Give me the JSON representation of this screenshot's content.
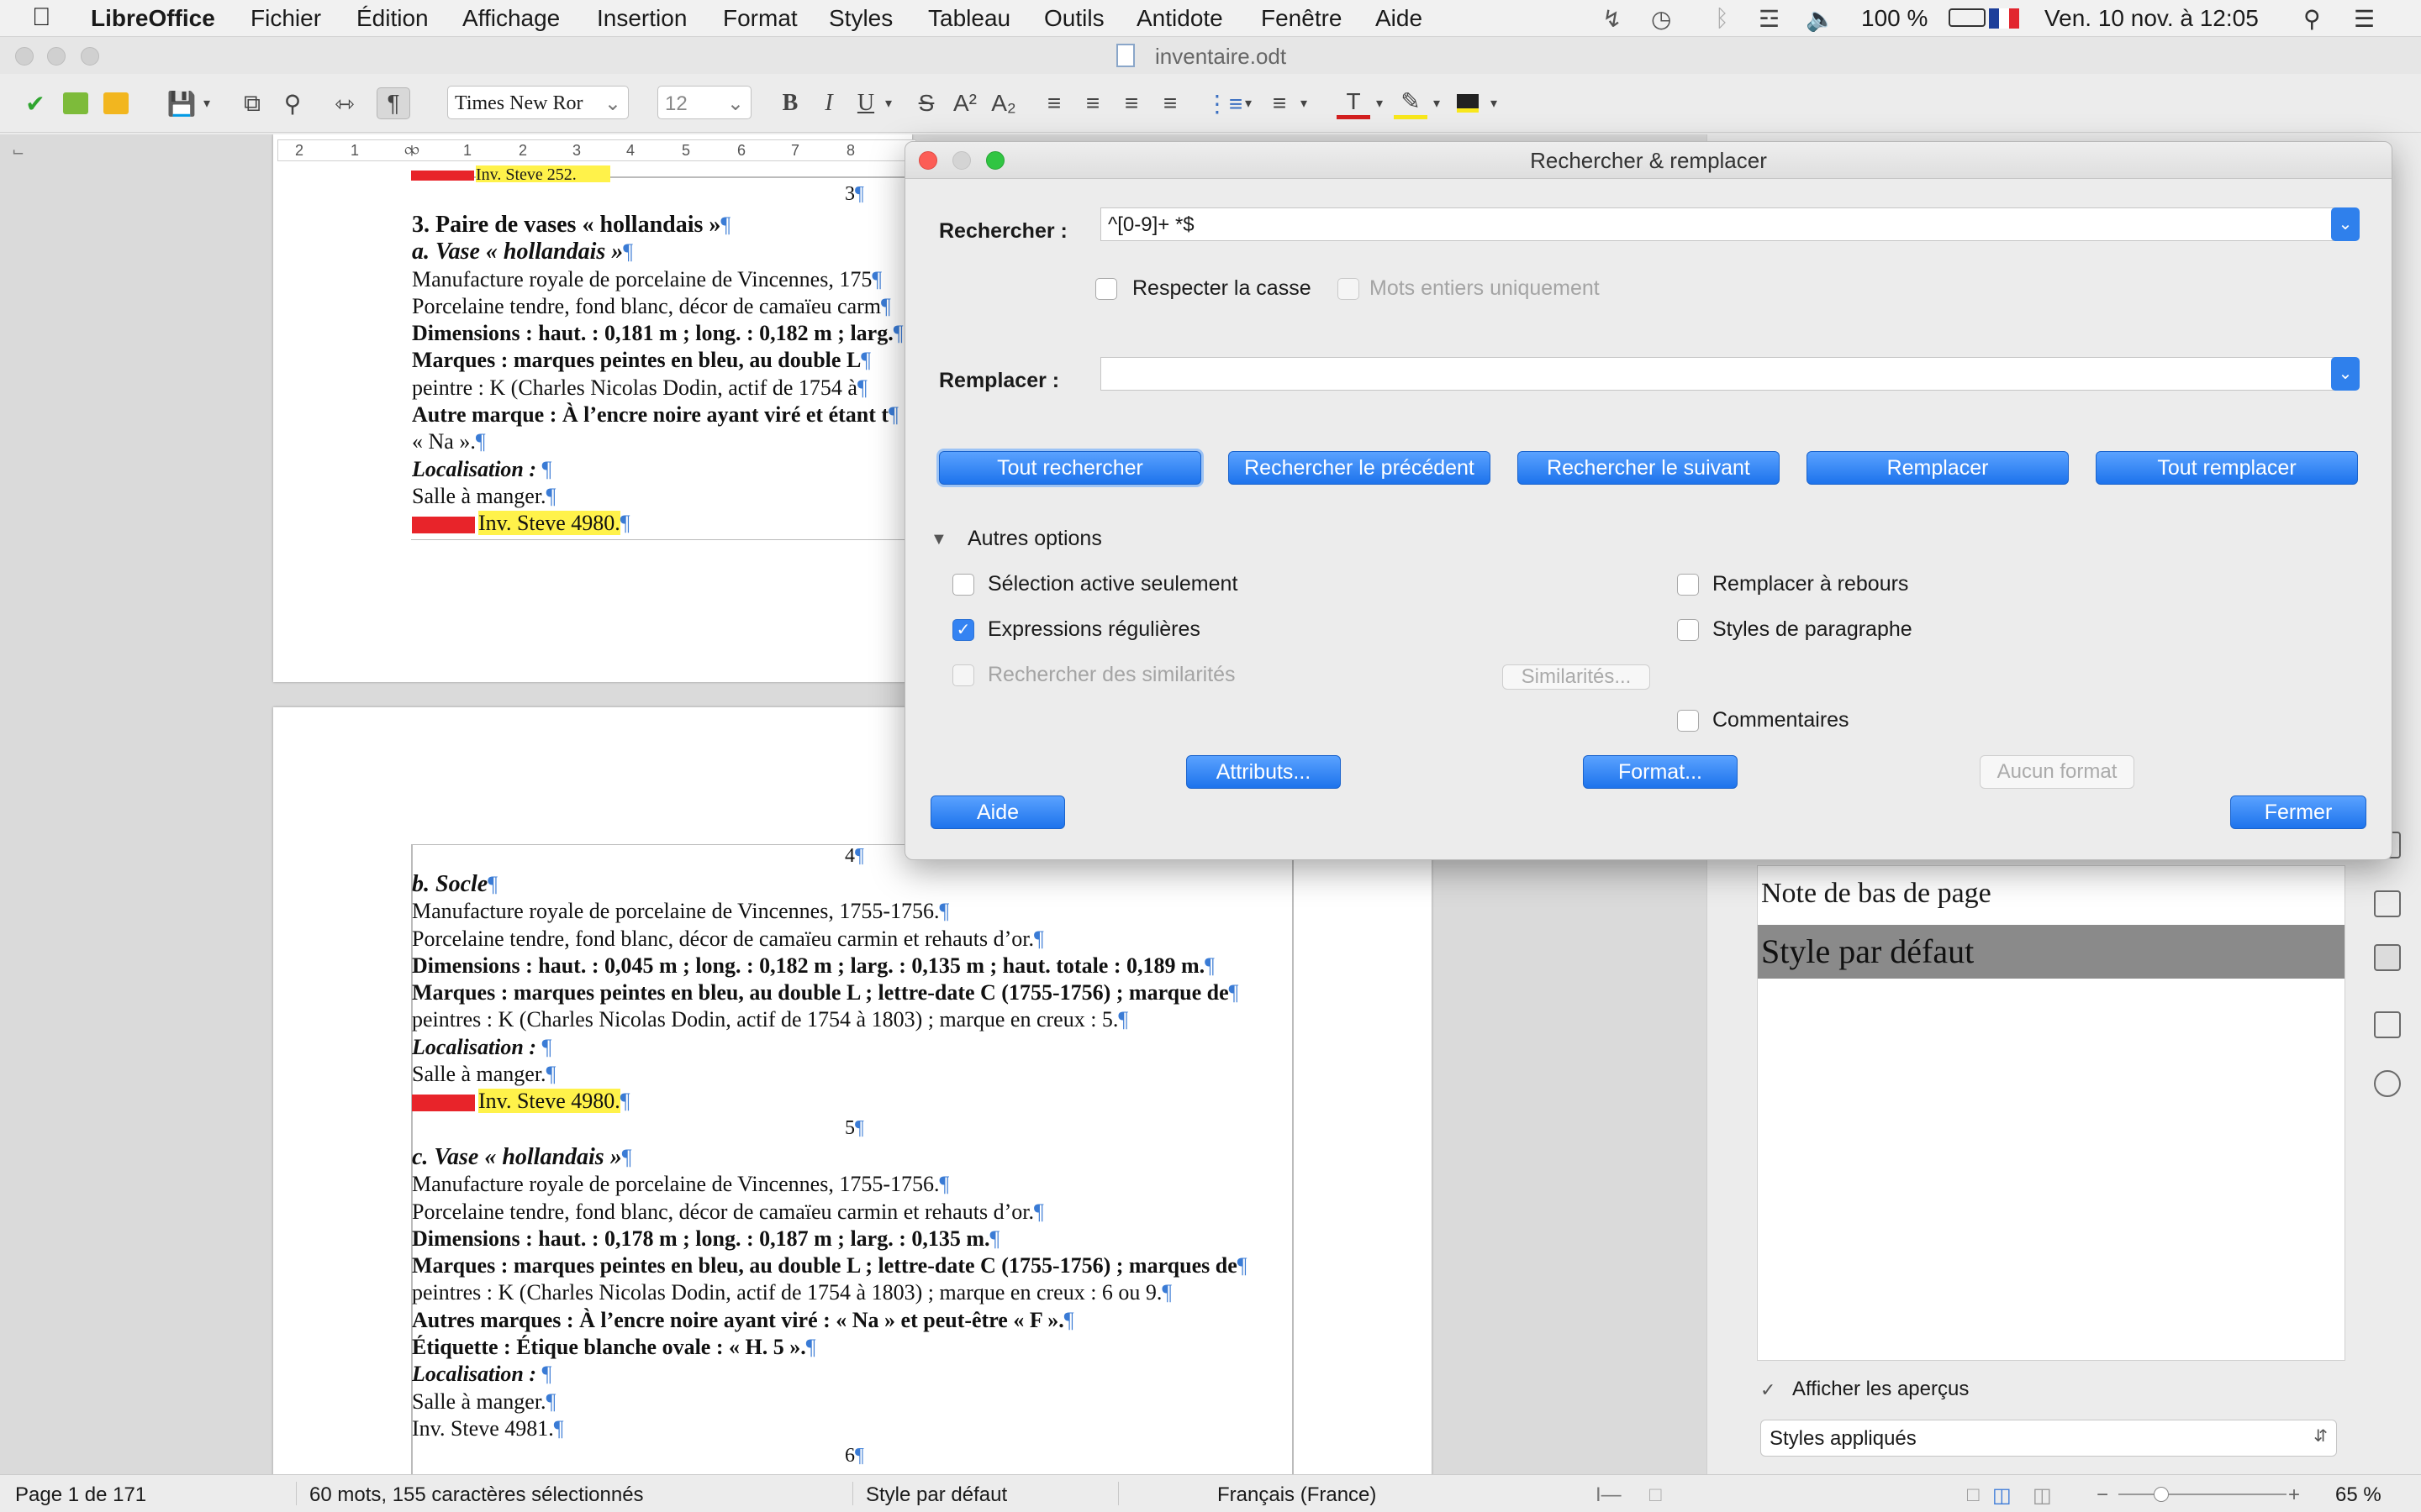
{
  "menubar": {
    "app_name": "LibreOffice",
    "items": [
      "Fichier",
      "Édition",
      "Affichage",
      "Insertion",
      "Format",
      "Styles",
      "Tableau",
      "Outils",
      "Antidote",
      "Fenêtre",
      "Aide"
    ],
    "battery": "100 %",
    "datetime": "Ven. 10 nov. à 12:05"
  },
  "window": {
    "title": "inventaire.odt"
  },
  "toolbar": {
    "font_name": "Times New Ror",
    "font_size": "12"
  },
  "ruler": {
    "ticks": [
      "2",
      "1",
      "1",
      "2",
      "3",
      "4",
      "5",
      "6",
      "7",
      "8"
    ]
  },
  "page1": {
    "top_line": "Inv. Steve 252.",
    "page_num": "3",
    "lines": [
      {
        "text": "3. Paire de vases « hollandais »",
        "style": "h"
      },
      {
        "text": "a. Vase « hollandais »",
        "style": "hi"
      },
      {
        "text": "Manufacture royale de porcelaine de Vincennes, 175",
        "style": ""
      },
      {
        "text": "Porcelaine tendre, fond blanc, décor de camaïeu carm",
        "style": ""
      },
      {
        "text": "Dimensions : haut. : 0,181 m ; long. : 0,182 m ; larg.",
        "style": "b"
      },
      {
        "text": "Marques : marques peintes en bleu, au double L",
        "style": "b"
      },
      {
        "text": "peintre : K (Charles Nicolas Dodin, actif de 1754 à",
        "style": ""
      },
      {
        "text": "Autre marque : À l’encre noire ayant viré et étant t",
        "style": "b"
      },
      {
        "text": "« Na ».",
        "style": ""
      },
      {
        "text": "Localisation : ",
        "style": "bi"
      },
      {
        "text": "Salle à manger.",
        "style": ""
      },
      {
        "text": "Inv. Steve 4980.",
        "style": "flag"
      }
    ]
  },
  "page2": {
    "page_num_top": "4",
    "page_num_mid": "5",
    "page_num_bottom": "6",
    "lines": [
      {
        "text": "b. Socle",
        "style": "hi"
      },
      {
        "text": "Manufacture royale de porcelaine de Vincennes, 1755-1756.",
        "style": ""
      },
      {
        "text": "Porcelaine tendre, fond blanc, décor de camaïeu carmin et rehauts d’or.",
        "style": ""
      },
      {
        "text": "Dimensions : haut. : 0,045 m ; long. : 0,182 m ; larg. : 0,135 m ; haut. totale : 0,189 m.",
        "style": "b"
      },
      {
        "text": "Marques : marques peintes en bleu, au double L ; lettre-date C (1755-1756) ; marque de",
        "style": "b"
      },
      {
        "text": "peintres : K (Charles Nicolas Dodin, actif de 1754 à 1803) ; marque en creux : 5.",
        "style": ""
      },
      {
        "text": "Localisation : ",
        "style": "bi"
      },
      {
        "text": "Salle à manger.",
        "style": ""
      },
      {
        "text": "Inv. Steve 4980.",
        "style": "flag"
      }
    ],
    "lines2": [
      {
        "text": "c. Vase « hollandais »",
        "style": "hi"
      },
      {
        "text": "Manufacture royale de porcelaine de Vincennes, 1755-1756.",
        "style": ""
      },
      {
        "text": "Porcelaine tendre, fond blanc, décor de camaïeu carmin et rehauts d’or.",
        "style": ""
      },
      {
        "text": "Dimensions : haut. : 0,178 m ; long. : 0,187 m ; larg. : 0,135 m.",
        "style": "b"
      },
      {
        "text": "Marques : marques peintes en bleu, au double L ; lettre-date C (1755-1756) ; marques de",
        "style": "b"
      },
      {
        "text": "peintres : K (Charles Nicolas Dodin, actif de 1754 à 1803) ; marque en creux : 6 ou 9.",
        "style": ""
      },
      {
        "text": "Autres marques : À l’encre noire ayant viré : « Na » et peut-être « F ».",
        "style": "b"
      },
      {
        "text": "Étiquette : Étique blanche ovale : « H. 5 ».",
        "style": "b"
      },
      {
        "text": "Localisation : ",
        "style": "bi"
      },
      {
        "text": "Salle à manger.",
        "style": ""
      },
      {
        "text": "Inv. Steve 4981.",
        "style": ""
      }
    ]
  },
  "dialog": {
    "title": "Rechercher & remplacer",
    "search_label": "Rechercher :",
    "search_value": "^[0-9]+ *$",
    "match_case": "Respecter la casse",
    "whole_words": "Mots entiers uniquement",
    "replace_label": "Remplacer :",
    "replace_value": "",
    "btn_find_all": "Tout rechercher",
    "btn_find_prev": "Rechercher le précédent",
    "btn_find_next": "Rechercher le suivant",
    "btn_replace": "Remplacer",
    "btn_replace_all": "Tout remplacer",
    "other_options": "Autres options",
    "opt_selection": "Sélection active seulement",
    "opt_regex": "Expressions régulières",
    "opt_similarity": "Rechercher des similarités",
    "btn_similarities": "Similarités...",
    "opt_backwards": "Remplacer à rebours",
    "opt_para_styles": "Styles de paragraphe",
    "opt_comments": "Commentaires",
    "btn_attributes": "Attributs...",
    "btn_format": "Format...",
    "btn_no_format": "Aucun format",
    "btn_help": "Aide",
    "btn_close": "Fermer"
  },
  "sidebar": {
    "styles": [
      "Note de bas de page",
      "Style par défaut"
    ],
    "show_previews": "Afficher les aperçus",
    "filter": "Styles appliqués"
  },
  "statusbar": {
    "page": "Page 1 de 171",
    "selection": "60 mots, 155 caractères sélectionnés",
    "style": "Style par défaut",
    "language": "Français (France)",
    "zoom": "65 %"
  }
}
